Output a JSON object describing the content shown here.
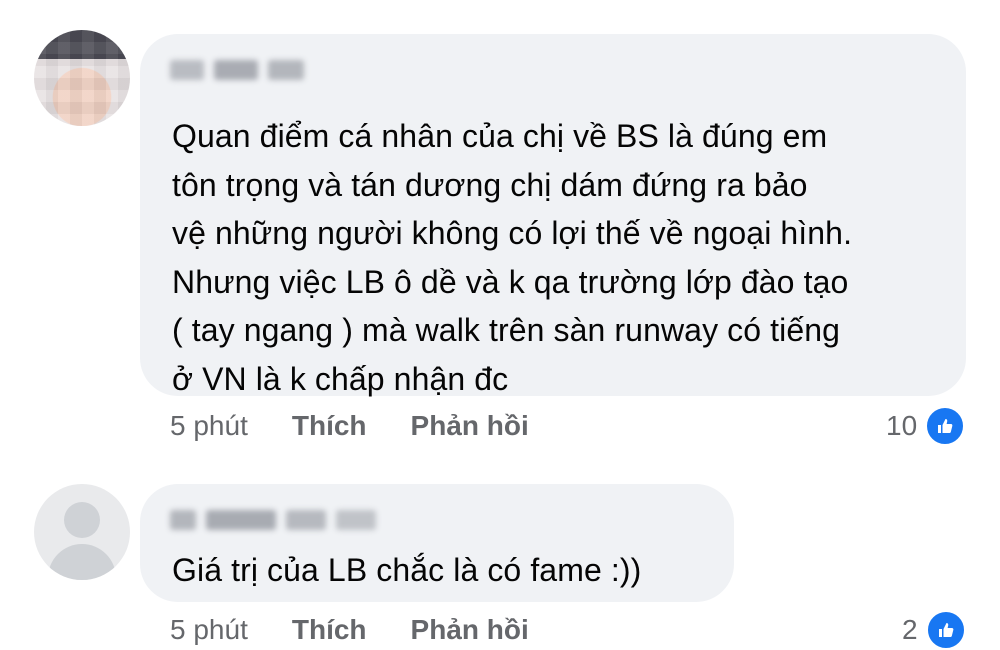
{
  "comments": [
    {
      "text": "Quan điểm cá nhân của chị về BS là đúng em\ntôn trọng và tán dương chị dám đứng ra bảo\nvệ những người không có lợi thế về ngoại hình.\nNhưng việc LB ô dề và k qa trường lớp đào tạo\n( tay ngang ) mà walk trên sàn runway có tiếng\nở VN là k chấp nhận đc",
      "time": "5 phút",
      "like_label": "Thích",
      "reply_label": "Phản hồi",
      "reaction_count": "10",
      "reaction_icon": "like-icon"
    },
    {
      "text": "Giá trị của LB chắc là có fame :))",
      "time": "5 phút",
      "like_label": "Thích",
      "reply_label": "Phản hồi",
      "reaction_count": "2",
      "reaction_icon": "like-icon"
    }
  ],
  "colors": {
    "bubble": "#f0f2f5",
    "text": "#050505",
    "meta": "#65676b",
    "like_blue": "#1877f2"
  }
}
